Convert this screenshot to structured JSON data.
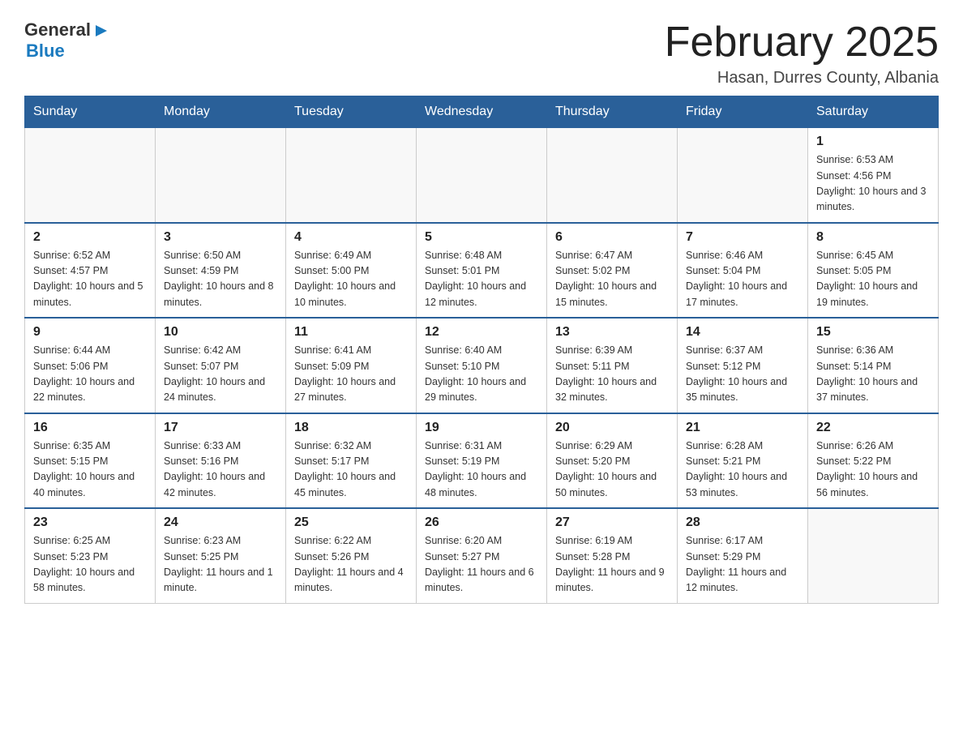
{
  "header": {
    "logo": {
      "line1": "General",
      "arrow": "▶",
      "line2": "Blue"
    },
    "title": "February 2025",
    "subtitle": "Hasan, Durres County, Albania"
  },
  "days_of_week": [
    "Sunday",
    "Monday",
    "Tuesday",
    "Wednesday",
    "Thursday",
    "Friday",
    "Saturday"
  ],
  "weeks": [
    [
      {
        "day": "",
        "info": ""
      },
      {
        "day": "",
        "info": ""
      },
      {
        "day": "",
        "info": ""
      },
      {
        "day": "",
        "info": ""
      },
      {
        "day": "",
        "info": ""
      },
      {
        "day": "",
        "info": ""
      },
      {
        "day": "1",
        "info": "Sunrise: 6:53 AM\nSunset: 4:56 PM\nDaylight: 10 hours and 3 minutes."
      }
    ],
    [
      {
        "day": "2",
        "info": "Sunrise: 6:52 AM\nSunset: 4:57 PM\nDaylight: 10 hours and 5 minutes."
      },
      {
        "day": "3",
        "info": "Sunrise: 6:50 AM\nSunset: 4:59 PM\nDaylight: 10 hours and 8 minutes."
      },
      {
        "day": "4",
        "info": "Sunrise: 6:49 AM\nSunset: 5:00 PM\nDaylight: 10 hours and 10 minutes."
      },
      {
        "day": "5",
        "info": "Sunrise: 6:48 AM\nSunset: 5:01 PM\nDaylight: 10 hours and 12 minutes."
      },
      {
        "day": "6",
        "info": "Sunrise: 6:47 AM\nSunset: 5:02 PM\nDaylight: 10 hours and 15 minutes."
      },
      {
        "day": "7",
        "info": "Sunrise: 6:46 AM\nSunset: 5:04 PM\nDaylight: 10 hours and 17 minutes."
      },
      {
        "day": "8",
        "info": "Sunrise: 6:45 AM\nSunset: 5:05 PM\nDaylight: 10 hours and 19 minutes."
      }
    ],
    [
      {
        "day": "9",
        "info": "Sunrise: 6:44 AM\nSunset: 5:06 PM\nDaylight: 10 hours and 22 minutes."
      },
      {
        "day": "10",
        "info": "Sunrise: 6:42 AM\nSunset: 5:07 PM\nDaylight: 10 hours and 24 minutes."
      },
      {
        "day": "11",
        "info": "Sunrise: 6:41 AM\nSunset: 5:09 PM\nDaylight: 10 hours and 27 minutes."
      },
      {
        "day": "12",
        "info": "Sunrise: 6:40 AM\nSunset: 5:10 PM\nDaylight: 10 hours and 29 minutes."
      },
      {
        "day": "13",
        "info": "Sunrise: 6:39 AM\nSunset: 5:11 PM\nDaylight: 10 hours and 32 minutes."
      },
      {
        "day": "14",
        "info": "Sunrise: 6:37 AM\nSunset: 5:12 PM\nDaylight: 10 hours and 35 minutes."
      },
      {
        "day": "15",
        "info": "Sunrise: 6:36 AM\nSunset: 5:14 PM\nDaylight: 10 hours and 37 minutes."
      }
    ],
    [
      {
        "day": "16",
        "info": "Sunrise: 6:35 AM\nSunset: 5:15 PM\nDaylight: 10 hours and 40 minutes."
      },
      {
        "day": "17",
        "info": "Sunrise: 6:33 AM\nSunset: 5:16 PM\nDaylight: 10 hours and 42 minutes."
      },
      {
        "day": "18",
        "info": "Sunrise: 6:32 AM\nSunset: 5:17 PM\nDaylight: 10 hours and 45 minutes."
      },
      {
        "day": "19",
        "info": "Sunrise: 6:31 AM\nSunset: 5:19 PM\nDaylight: 10 hours and 48 minutes."
      },
      {
        "day": "20",
        "info": "Sunrise: 6:29 AM\nSunset: 5:20 PM\nDaylight: 10 hours and 50 minutes."
      },
      {
        "day": "21",
        "info": "Sunrise: 6:28 AM\nSunset: 5:21 PM\nDaylight: 10 hours and 53 minutes."
      },
      {
        "day": "22",
        "info": "Sunrise: 6:26 AM\nSunset: 5:22 PM\nDaylight: 10 hours and 56 minutes."
      }
    ],
    [
      {
        "day": "23",
        "info": "Sunrise: 6:25 AM\nSunset: 5:23 PM\nDaylight: 10 hours and 58 minutes."
      },
      {
        "day": "24",
        "info": "Sunrise: 6:23 AM\nSunset: 5:25 PM\nDaylight: 11 hours and 1 minute."
      },
      {
        "day": "25",
        "info": "Sunrise: 6:22 AM\nSunset: 5:26 PM\nDaylight: 11 hours and 4 minutes."
      },
      {
        "day": "26",
        "info": "Sunrise: 6:20 AM\nSunset: 5:27 PM\nDaylight: 11 hours and 6 minutes."
      },
      {
        "day": "27",
        "info": "Sunrise: 6:19 AM\nSunset: 5:28 PM\nDaylight: 11 hours and 9 minutes."
      },
      {
        "day": "28",
        "info": "Sunrise: 6:17 AM\nSunset: 5:29 PM\nDaylight: 11 hours and 12 minutes."
      },
      {
        "day": "",
        "info": ""
      }
    ]
  ]
}
